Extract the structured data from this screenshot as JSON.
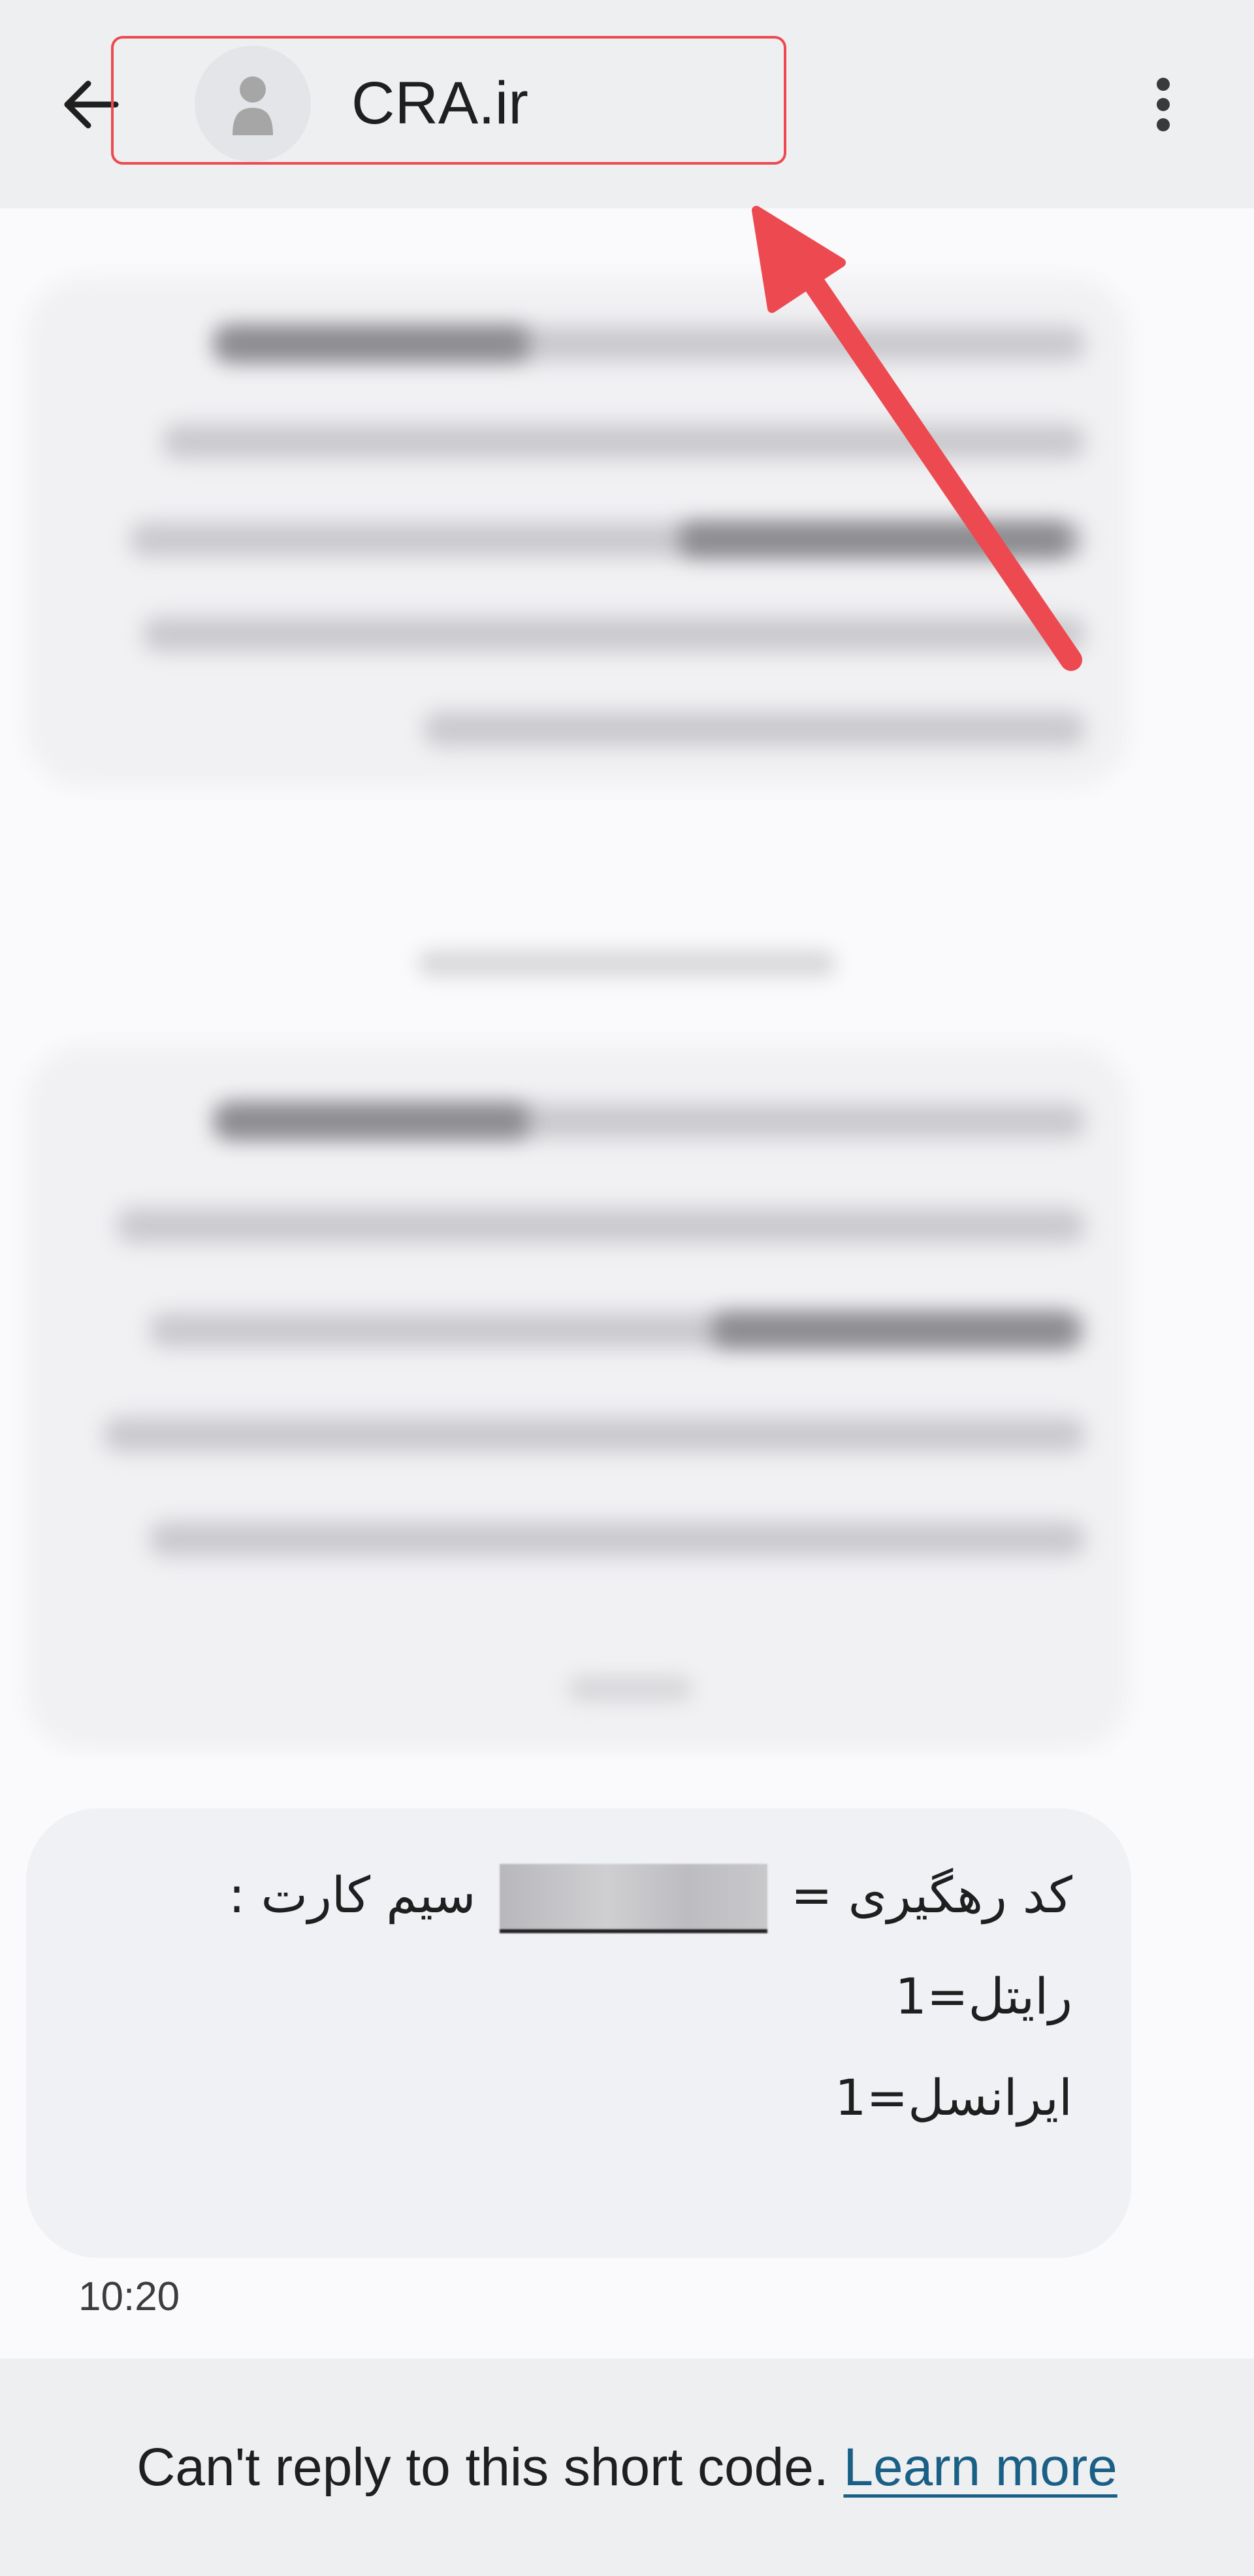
{
  "header": {
    "back_icon": "arrow-left-icon",
    "contact_name": "CRA.ir",
    "avatar_icon": "person-icon",
    "more_icon": "more-vert-icon"
  },
  "annotation": {
    "type": "arrow",
    "color": "#ec4a50"
  },
  "messages": [
    {
      "sender": "incoming",
      "lines": [
        "کد رهگیری =",
        "سیم کارت :",
        "رایتل=1",
        "ایرانسل=1"
      ],
      "time": "10:20"
    }
  ],
  "footer": {
    "notice": "Can't reply to this short code.",
    "link_label": "Learn more",
    "link_color": "#1a5f86"
  }
}
